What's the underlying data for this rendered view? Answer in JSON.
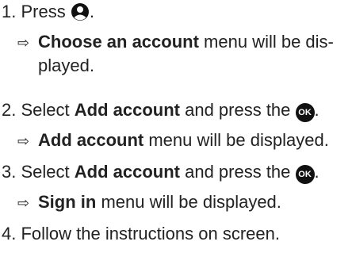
{
  "steps": [
    {
      "num": "1.",
      "text_a": "Press ",
      "text_b": "."
    },
    {
      "result_arrow": "⇨",
      "bold": "Choose an account",
      "rest": " menu will be dis-",
      "cont": "played."
    },
    {
      "num": "2.",
      "text_a": "Select ",
      "bold": "Add account",
      "text_b": " and press the ",
      "end": "."
    },
    {
      "result_arrow": "⇨",
      "bold": "Add account",
      "rest": " menu will be displayed."
    },
    {
      "num": "3.",
      "text_a": "Select ",
      "bold": "Add account",
      "text_b": " and press the ",
      "end": "."
    },
    {
      "result_arrow": "⇨",
      "bold": "Sign in",
      "rest": " menu will be displayed."
    },
    {
      "num": "4.",
      "text_a": "Follow the instructions on screen."
    }
  ],
  "ok_label": "OK",
  "icons": {
    "profile": "account-circle-icon",
    "ok": "ok-button-icon",
    "arrow": "right-arrow-icon"
  }
}
